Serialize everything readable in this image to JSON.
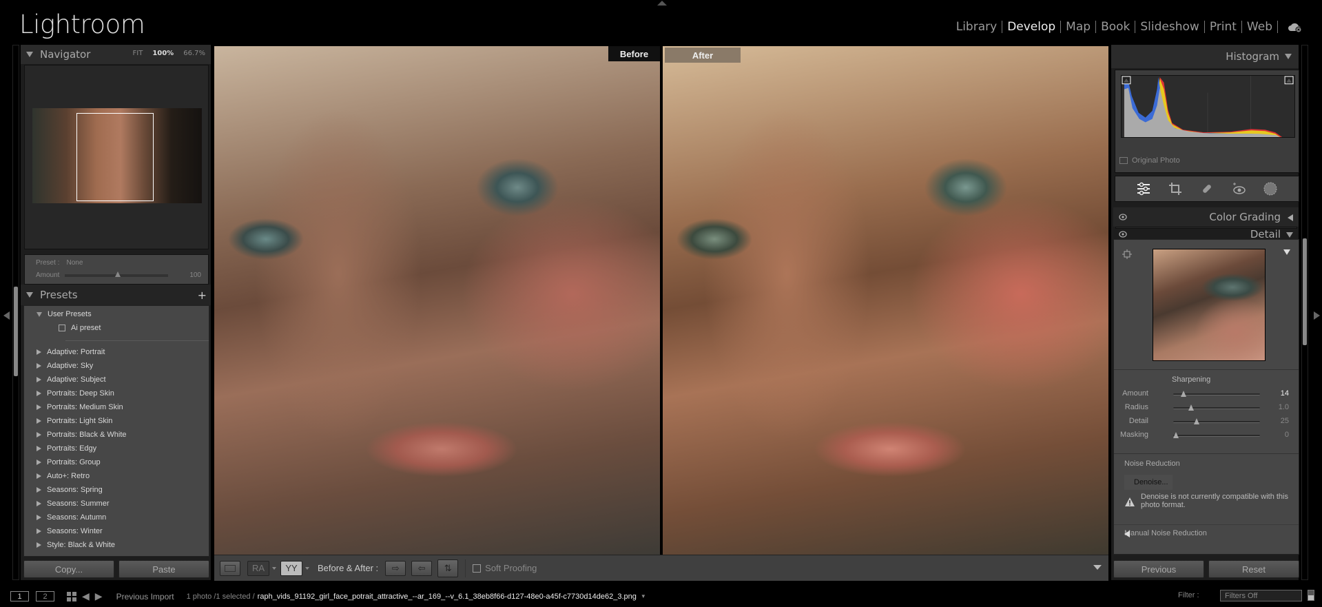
{
  "app": {
    "title": "Lightroom"
  },
  "modules": [
    {
      "label": "Library",
      "active": false
    },
    {
      "label": "Develop",
      "active": true
    },
    {
      "label": "Map",
      "active": false
    },
    {
      "label": "Book",
      "active": false
    },
    {
      "label": "Slideshow",
      "active": false
    },
    {
      "label": "Print",
      "active": false
    },
    {
      "label": "Web",
      "active": false
    }
  ],
  "navigator": {
    "title": "Navigator",
    "zoom_options": [
      "FIT",
      "100%",
      "66.7%"
    ],
    "selected_zoom": "100%",
    "preset_label": "Preset :",
    "preset_value": "None",
    "amount_label": "Amount",
    "amount_value": "100"
  },
  "presets": {
    "title": "Presets",
    "add_icon": "+",
    "user_group": "User Presets",
    "user_items": [
      "Ai preset"
    ],
    "groups": [
      "Adaptive: Portrait",
      "Adaptive: Sky",
      "Adaptive: Subject",
      "Portraits: Deep Skin",
      "Portraits: Medium Skin",
      "Portraits: Light Skin",
      "Portraits: Black & White",
      "Portraits: Edgy",
      "Portraits: Group",
      "Auto+: Retro",
      "Seasons: Spring",
      "Seasons: Summer",
      "Seasons: Autumn",
      "Seasons: Winter",
      "Style: Black & White"
    ]
  },
  "left_buttons": {
    "copy": "Copy...",
    "paste": "Paste"
  },
  "view": {
    "before_label": "Before",
    "after_label": "After"
  },
  "toolbar": {
    "loupe_icon": "loupe-view",
    "ra_label": "RA",
    "yy_label": "YY",
    "before_after_label": "Before & After :",
    "soft_proofing_label": "Soft Proofing",
    "soft_proofing_checked": false
  },
  "histogram": {
    "title": "Histogram",
    "original_photo_label": "Original Photo"
  },
  "tools": [
    "edit-sliders",
    "crop",
    "healing",
    "red-eye",
    "masking"
  ],
  "sections": {
    "color_grading": "Color Grading",
    "detail": "Detail"
  },
  "sharpening": {
    "title": "Sharpening",
    "sliders": [
      {
        "label": "Amount",
        "value": "14",
        "fraction": 0.093,
        "active": true
      },
      {
        "label": "Radius",
        "value": "1.0",
        "fraction": 0.19,
        "active": false
      },
      {
        "label": "Detail",
        "value": "25",
        "fraction": 0.25,
        "active": false
      },
      {
        "label": "Masking",
        "value": "0",
        "fraction": 0.0,
        "active": false
      }
    ]
  },
  "noise_reduction": {
    "title": "Noise Reduction",
    "denoise_label": "Denoise...",
    "warning": "Denoise is not currently compatible with this photo format.",
    "manual_label": "Manual Noise Reduction"
  },
  "right_buttons": {
    "previous": "Previous",
    "reset": "Reset"
  },
  "filmstrip": {
    "screen1": "1",
    "screen2": "2",
    "source": "Previous Import",
    "count": "1 photo /1 selected /",
    "filename": "raph_vids_91192_girl_face_potrait_attractive_--ar_169_--v_6.1_38eb8f66-d127-48e0-a45f-c7730d14de62_3.png",
    "filter_label": "Filter :",
    "filter_value": "Filters Off"
  }
}
